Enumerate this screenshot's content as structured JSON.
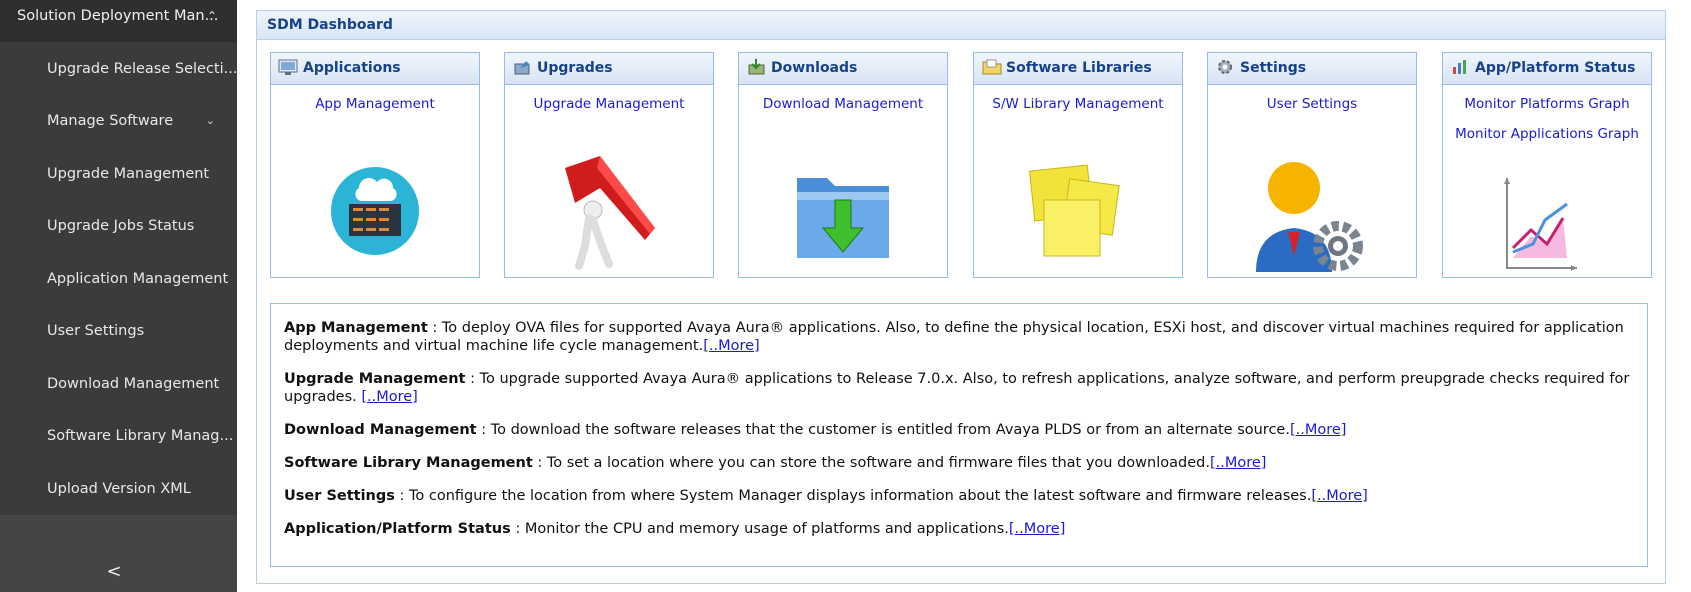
{
  "sidebar": {
    "header": "Solution Deployment Man...",
    "items": [
      {
        "label": "Upgrade Release Selecti..."
      },
      {
        "label": "Manage Software"
      },
      {
        "label": "Upgrade Management"
      },
      {
        "label": "Upgrade Jobs Status"
      },
      {
        "label": "Application Management"
      },
      {
        "label": "User Settings"
      },
      {
        "label": "Download Management"
      },
      {
        "label": "Software Library Manag..."
      },
      {
        "label": "Upload Version XML"
      }
    ],
    "collapse_glyph": "<"
  },
  "dashboard": {
    "title": "SDM Dashboard",
    "cards": [
      {
        "title": "Applications",
        "icon": "applications-icon",
        "links": [
          "App Management"
        ]
      },
      {
        "title": "Upgrades",
        "icon": "upgrades-icon",
        "links": [
          "Upgrade Management"
        ]
      },
      {
        "title": "Downloads",
        "icon": "downloads-icon",
        "links": [
          "Download Management"
        ]
      },
      {
        "title": "Software Libraries",
        "icon": "software-libraries-icon",
        "links": [
          "S/W Library Management"
        ]
      },
      {
        "title": "Settings",
        "icon": "settings-gear-icon",
        "links": [
          "User Settings"
        ]
      },
      {
        "title": "App/Platform Status",
        "icon": "app-platform-status-icon",
        "links": [
          "Monitor Platforms Graph",
          "Monitor Applications Graph"
        ]
      }
    ],
    "descriptions": [
      {
        "term": "App Management",
        "text": " : To deploy OVA files for supported Avaya Aura® applications. Also, to define the physical location, ESXi host, and discover virtual machines required for application deployments and virtual machine life cycle management.",
        "more": "[..More]"
      },
      {
        "term": "Upgrade Management",
        "text": " : To upgrade supported Avaya Aura® applications to Release 7.0.x. Also, to refresh applications, analyze software, and perform preupgrade checks required for upgrades.",
        "more": "[..More]"
      },
      {
        "term": "Download Management",
        "text": " : To download the software releases that the customer is entitled from Avaya PLDS or from an alternate source.",
        "more": "[..More]"
      },
      {
        "term": "Software Library Management",
        "text": " : To set a location where you can store the software and firmware files that you downloaded.",
        "more": "[..More]"
      },
      {
        "term": "User Settings",
        "text": " : To configure the location from where System Manager displays information about the latest software and firmware releases.",
        "more": "[..More]"
      },
      {
        "term": "Application/Platform Status",
        "text": " : Monitor the CPU and memory usage of platforms and applications.",
        "more": "[..More]"
      }
    ]
  },
  "colors": {
    "sidebar_bg": "#3b3b3b",
    "title_text": "#15428b",
    "link": "#1a1ad6",
    "border": "#99bbe8"
  }
}
